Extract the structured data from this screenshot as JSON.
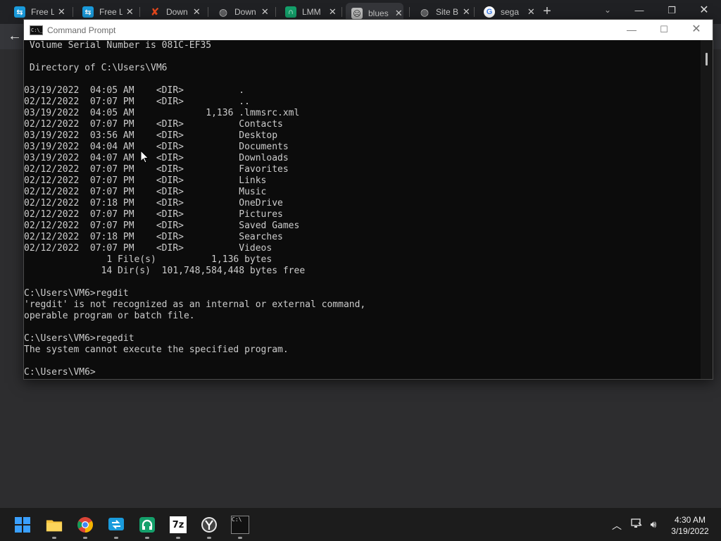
{
  "browser": {
    "tabs": [
      {
        "label": "Free L",
        "icon": "remote-desktop-icon",
        "color": "#1a9bdc"
      },
      {
        "label": "Free L",
        "icon": "remote-desktop-icon",
        "color": "#1a9bdc"
      },
      {
        "label": "Down",
        "icon": "x-logo-icon",
        "color": "#e8491d"
      },
      {
        "label": "Down",
        "icon": "globe-icon",
        "color": "#bdbdbd"
      },
      {
        "label": "LMM",
        "icon": "headphones-icon",
        "color": "#14a06b"
      },
      {
        "label": "blues",
        "icon": "sad-face-icon",
        "color": "#bdbdbd"
      },
      {
        "label": "Site B",
        "icon": "globe-icon",
        "color": "#bdbdbd"
      },
      {
        "label": "sega",
        "icon": "google-icon",
        "color": "#4285f4"
      }
    ],
    "active_tab_index": 5,
    "close_glyph": "✕",
    "newtab_glyph": "+",
    "back_glyph": "←"
  },
  "cmd": {
    "title": "Command Prompt",
    "app_icon_text": "C:\\_",
    "lines": [
      " Volume Serial Number is 081C-EF35",
      "",
      " Directory of C:\\Users\\VM6",
      "",
      "03/19/2022  04:05 AM    <DIR>          .",
      "02/12/2022  07:07 PM    <DIR>          ..",
      "03/19/2022  04:05 AM             1,136 .lmmsrc.xml",
      "02/12/2022  07:07 PM    <DIR>          Contacts",
      "03/19/2022  03:56 AM    <DIR>          Desktop",
      "03/19/2022  04:04 AM    <DIR>          Documents",
      "03/19/2022  04:07 AM    <DIR>          Downloads",
      "02/12/2022  07:07 PM    <DIR>          Favorites",
      "02/12/2022  07:07 PM    <DIR>          Links",
      "02/12/2022  07:07 PM    <DIR>          Music",
      "02/12/2022  07:18 PM    <DIR>          OneDrive",
      "02/12/2022  07:07 PM    <DIR>          Pictures",
      "02/12/2022  07:07 PM    <DIR>          Saved Games",
      "02/12/2022  07:18 PM    <DIR>          Searches",
      "02/12/2022  07:07 PM    <DIR>          Videos",
      "               1 File(s)          1,136 bytes",
      "              14 Dir(s)  101,748,584,448 bytes free",
      "",
      "C:\\Users\\VM6>regdit",
      "'regdit' is not recognized as an internal or external command,",
      "operable program or batch file.",
      "",
      "C:\\Users\\VM6>regedit",
      "The system cannot execute the specified program.",
      "",
      "C:\\Users\\VM6>"
    ]
  },
  "taskbar": {
    "apps": [
      {
        "name": "start-button",
        "icon": "windows-logo-icon"
      },
      {
        "name": "file-explorer",
        "icon": "folder-icon"
      },
      {
        "name": "chrome",
        "icon": "chrome-icon"
      },
      {
        "name": "remote-desktop",
        "icon": "remote-desktop-icon"
      },
      {
        "name": "lmms",
        "icon": "headphones-icon"
      },
      {
        "name": "7zip",
        "icon": "seven-zip-icon",
        "text": "7z"
      },
      {
        "name": "app-yandex",
        "icon": "y-badge-icon"
      },
      {
        "name": "command-prompt",
        "icon": "terminal-icon",
        "text": "C:\\"
      }
    ],
    "time": "4:30 AM",
    "date": "3/19/2022",
    "accent": "#0a84ff"
  }
}
